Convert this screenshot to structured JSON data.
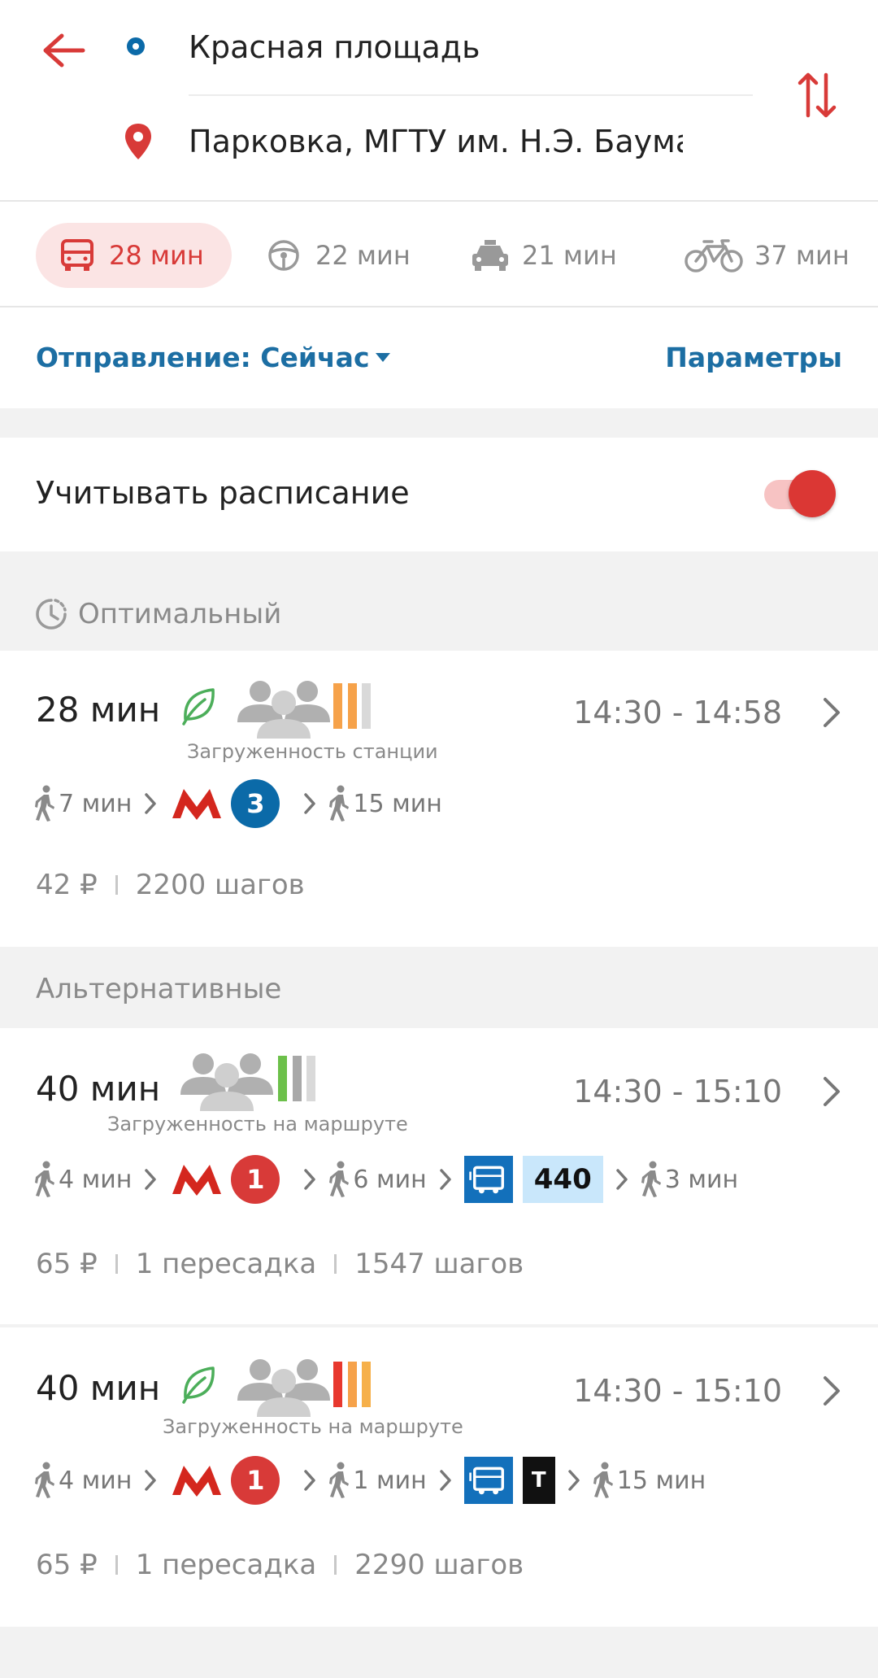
{
  "header": {
    "origin": "Красная площадь",
    "destination": "Парковка, МГТУ им. Н.Э. Баумана",
    "accent_color": "#d83a38",
    "origin_color": "#0b6aa8"
  },
  "modes": [
    {
      "icon": "bus-icon",
      "label": "28 мин",
      "active": true
    },
    {
      "icon": "steering-wheel-icon",
      "label": "22 мин",
      "active": false
    },
    {
      "icon": "taxi-icon",
      "label": "21 мин",
      "active": false
    },
    {
      "icon": "bicycle-icon",
      "label": "37 мин",
      "active": false
    }
  ],
  "departure": {
    "label": "Отправление: Сейчас",
    "params": "Параметры"
  },
  "schedule": {
    "label": "Учитывать расписание",
    "enabled": true
  },
  "sections": {
    "optimal": "Оптимальный",
    "alternatives": "Альтернативные"
  },
  "routes": [
    {
      "duration": "28 мин",
      "eco": true,
      "load_label": "Загруженность станции",
      "load_colors": [
        "#f6a24a",
        "#f6a24a",
        "#d9d9d9"
      ],
      "times": "14:30 - 14:58",
      "legs": {
        "walk1": "7 мин",
        "metro_line": "3",
        "metro_color": "#0b6aa8",
        "walk2": "15 мин"
      },
      "meta": [
        "42 ₽",
        "2200 шагов"
      ]
    },
    {
      "duration": "40 мин",
      "eco": false,
      "load_label": "Загруженность на маршруте",
      "load_colors": [
        "#6cc04a",
        "#a8a8a8",
        "#d9d9d9"
      ],
      "times": "14:30 - 15:10",
      "legs": {
        "walk1": "4 мин",
        "metro_line": "1",
        "metro_color": "#d83a38",
        "walk2": "6 мин",
        "bus_number": "440",
        "walk3": "3 мин"
      },
      "meta": [
        "65 ₽",
        "1 пересадка",
        "1547 шагов"
      ]
    },
    {
      "duration": "40 мин",
      "eco": true,
      "load_label": "Загруженность на маршруте",
      "load_colors": [
        "#e8382e",
        "#f6a24a",
        "#f6b04a"
      ],
      "times": "14:30 - 15:10",
      "legs": {
        "walk1": "4 мин",
        "metro_line": "1",
        "metro_color": "#d83a38",
        "walk2": "1 мин",
        "tram_label": "Т",
        "walk3": "15 мин"
      },
      "meta": [
        "65 ₽",
        "1 пересадка",
        "2290 шагов"
      ]
    }
  ]
}
